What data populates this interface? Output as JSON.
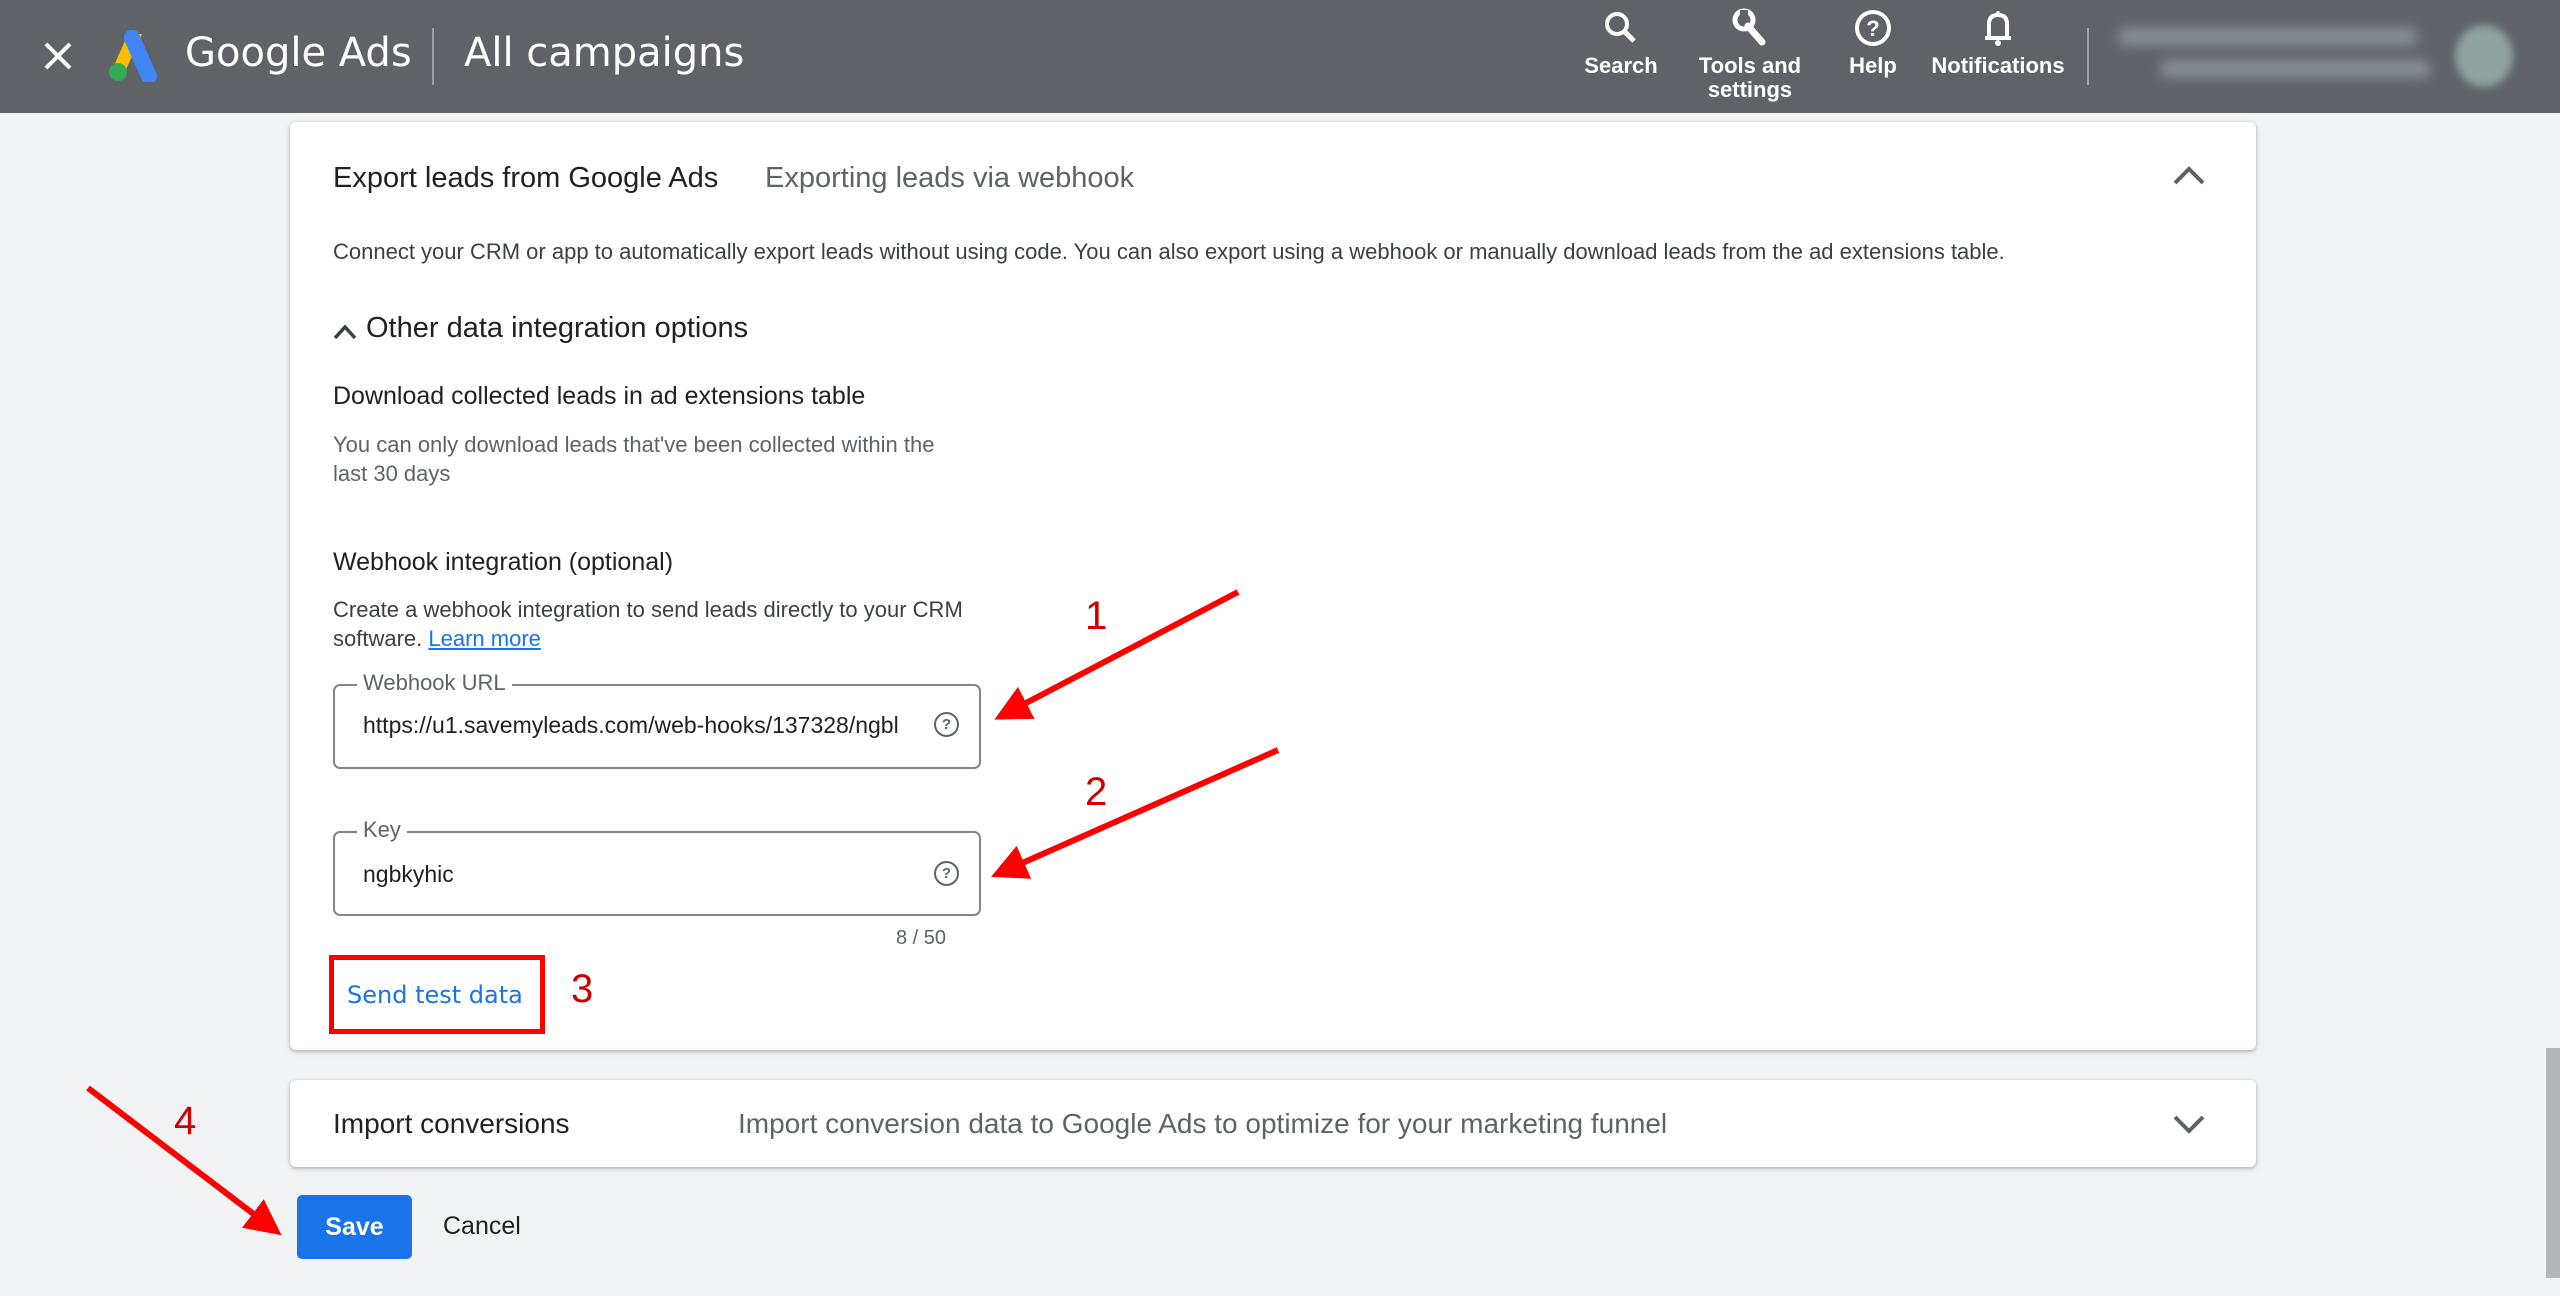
{
  "header": {
    "close_icon": "close-icon",
    "product_name": "Google Ads",
    "page_title": "All campaigns",
    "nav": [
      {
        "label": "Search",
        "icon": "search-icon"
      },
      {
        "label": "Tools and settings",
        "line1": "Tools and",
        "line2": "settings",
        "icon": "wrench-icon"
      },
      {
        "label": "Help",
        "icon": "help-icon"
      },
      {
        "label": "Notifications",
        "icon": "bell-icon"
      }
    ],
    "account": {
      "blurred": true
    }
  },
  "export_card": {
    "title": "Export leads from Google Ads",
    "subtitle": "Exporting leads via webhook",
    "collapse_icon": "chevron-up-icon",
    "description": "Connect your CRM or app to automatically export leads without using code. You can also export using a webhook or manually download leads from the ad extensions table.",
    "other_options": {
      "label": "Other data integration options",
      "expanded": true
    },
    "download": {
      "heading": "Download collected leads in ad extensions table",
      "desc_line1": "You can only download leads that've been collected within the",
      "desc_line2": "last 30 days"
    },
    "webhook": {
      "heading": "Webhook integration (optional)",
      "desc_line1": "Create a webhook integration to send leads directly to your CRM",
      "desc_line2": "software.",
      "learn_more": "Learn more",
      "url_field": {
        "label": "Webhook URL",
        "value": "https://u1.savemyleads.com/web-hooks/137328/ngbl"
      },
      "key_field": {
        "label": "Key",
        "value": "ngbkyhic",
        "counter": "8 / 50"
      },
      "send_test": "Send test data"
    }
  },
  "import_card": {
    "title": "Import conversions",
    "subtitle": "Import conversion data to Google Ads to optimize for your marketing funnel",
    "expand_icon": "chevron-down-icon"
  },
  "actions": {
    "save": "Save",
    "cancel": "Cancel"
  },
  "annotations": {
    "steps": [
      "1",
      "2",
      "3",
      "4"
    ],
    "color": "#ff0000"
  },
  "colors": {
    "header_bg": "#5f6368",
    "page_bg": "#f1f3f4",
    "primary_blue": "#1a73e8"
  }
}
